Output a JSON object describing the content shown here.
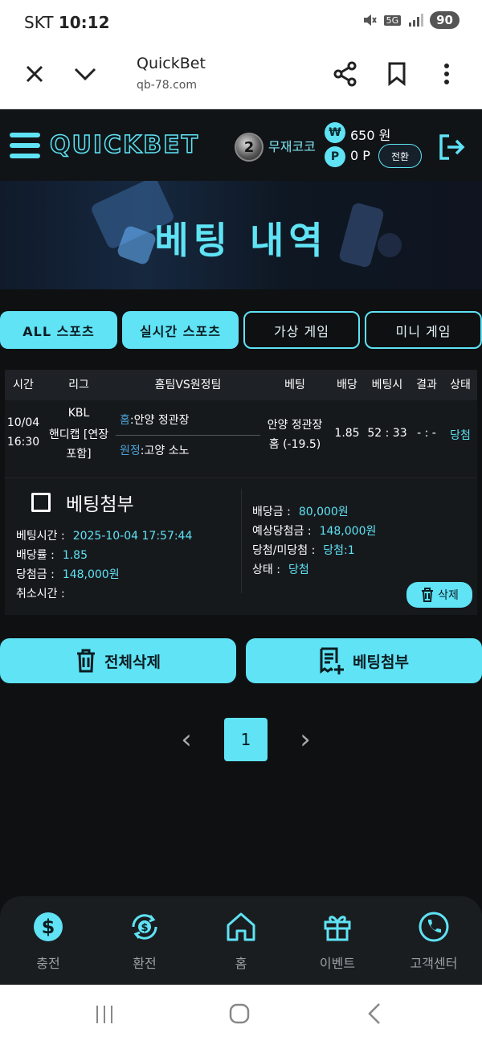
{
  "status_bar": {
    "carrier": "SKT",
    "time": "10:12",
    "network": "5G",
    "battery": "90"
  },
  "browser": {
    "title": "QuickBet",
    "url": "qb-78.com"
  },
  "header": {
    "logo": "QUICKBET",
    "level": "2",
    "username": "무재코코",
    "won_symbol": "₩",
    "won_value": "650 원",
    "point_symbol": "P",
    "point_value": "0 P",
    "convert_label": "전환"
  },
  "banner": {
    "title": "베팅 내역"
  },
  "tabs": [
    {
      "label": "ALL 스포츠",
      "active": true
    },
    {
      "label": "실시간 스포츠",
      "active": true
    },
    {
      "label": "가상 게임",
      "active": false
    },
    {
      "label": "미니 게임",
      "active": false
    }
  ],
  "table": {
    "headers": [
      "시간",
      "리그",
      "홈팀VS원정팀",
      "베팅",
      "배당",
      "베팅시",
      "결과",
      "상태"
    ],
    "row": {
      "date": "10/04",
      "time": "16:30",
      "league_1": "KBL",
      "league_2": "핸디캡 [연장",
      "league_3": "포함]",
      "home_label": "홈",
      "home_team": ":안양 정관장",
      "away_label": "원정",
      "away_team": ":고양 소노",
      "bet_1": "안양 정관장",
      "bet_2": "홈  (-19.5)",
      "odds": "1.85",
      "bet_time": "52 : 33",
      "result": "- : -",
      "status": "당첨"
    }
  },
  "detail": {
    "attach_label": "베팅첨부",
    "bet_time_label": "베팅시간 :",
    "bet_time_value": "2025-10-04 17:57:44",
    "odds_label": "배당률 :",
    "odds_value": "1.85",
    "win_amount_label": "당첨금 :",
    "win_amount_value": "148,000원",
    "cancel_time_label": "취소시간 :",
    "bet_amount_label": "배당금 :",
    "bet_amount_value": "80,000원",
    "expected_label": "예상당첨금 :",
    "expected_value": "148,000원",
    "winlose_label": "당첨/미당첨 :",
    "winlose_value": "당첨:1",
    "state_label": "상태 :",
    "state_value": "당첨",
    "delete_label": "삭제"
  },
  "actions": {
    "delete_all": "전체삭제",
    "attach_bet": "베팅첨부"
  },
  "pagination": {
    "current": "1",
    "prev": "‹",
    "next": "›"
  },
  "bottom_nav": [
    {
      "label": "충전",
      "icon": "dollar-icon"
    },
    {
      "label": "환전",
      "icon": "exchange-icon"
    },
    {
      "label": "홈",
      "icon": "home-icon"
    },
    {
      "label": "이벤트",
      "icon": "gift-icon"
    },
    {
      "label": "고객센터",
      "icon": "phone-icon"
    }
  ],
  "colors": {
    "accent": "#5fe3f5",
    "background": "#0e1012",
    "panel": "#16191c"
  }
}
